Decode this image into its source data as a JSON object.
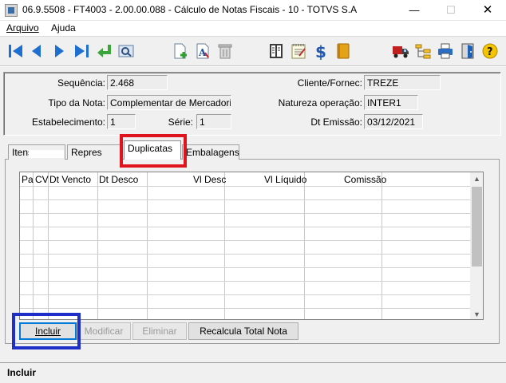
{
  "window": {
    "title": "06.9.5508 - FT4003 - 2.00.00.088 - Cálculo de Notas Fiscais - 10 - TOTVS S.A",
    "minimize": "—",
    "maximize": "☐",
    "close": "✕"
  },
  "menu": {
    "arquivo": "Arquivo",
    "ajuda": "Ajuda"
  },
  "toolbar": {
    "icons": [
      "first-icon",
      "previous-icon",
      "next-icon",
      "last-icon",
      "return-icon",
      "search-icon",
      "new-document-icon",
      "edit-text-icon",
      "trash-icon",
      "calculator-icon",
      "notes-icon",
      "dollar-icon",
      "book-icon",
      "truck-icon",
      "tree-icon",
      "print-icon",
      "exit-door-icon",
      "help-icon"
    ]
  },
  "header": {
    "sequencia_label": "Sequência:",
    "sequencia_value": "2.468",
    "tipo_label": "Tipo da Nota:",
    "tipo_value": "Complementar de Mercadoria",
    "estab_label": "Estabelecimento:",
    "estab_value": "1",
    "serie_label": "Série:",
    "serie_value": "1",
    "cliente_label": "Cliente/Fornec:",
    "cliente_value": "TREZE",
    "natureza_label": "Natureza operação:",
    "natureza_value": "INTER1",
    "dt_label": "Dt Emissão:",
    "dt_value": "03/12/2021"
  },
  "tabs": [
    {
      "label": "Itens"
    },
    {
      "label": "Repres"
    },
    {
      "label": "Duplicatas",
      "active": true
    },
    {
      "label": "Embalagens"
    }
  ],
  "grid": {
    "columns": [
      "Pa",
      "CV",
      "Dt Vencto",
      "Dt Desco",
      "Vl Desc",
      "Vl Líquido",
      "Comissão"
    ],
    "rows": []
  },
  "buttons": {
    "incluir": "Incluir",
    "modificar": "Modificar",
    "eliminar": "Eliminar",
    "recalcula": "Recalcula Total Nota"
  },
  "status": {
    "text": "Incluir"
  },
  "colors": {
    "highlight_red": "#e0141e",
    "highlight_blue": "#1e2fc8"
  }
}
